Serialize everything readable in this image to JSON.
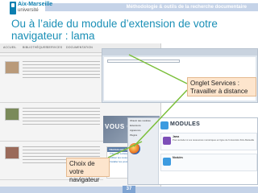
{
  "header": {
    "logo_name": "Aix-Marseille",
    "logo_sub": "université",
    "strip_text": "Méthodologie & outils de la recherche documentaire"
  },
  "slide": {
    "title": "Ou à l’aide du module d’extension de votre navigateur : lama"
  },
  "left_shot": {
    "tabs": [
      "ACCUEIL",
      "BIBLIOTHÈQUES",
      "SERVICES",
      "DOCUMENTATION"
    ],
    "vous_text": "VOUS QUESTION",
    "side_panel_title": "TRAVAILLER À DISTANCE",
    "side_panel_items": [
      "Travailler à distance",
      "Utiliser les ressources",
      "Installer les postes"
    ]
  },
  "modules": {
    "title": "MODULES",
    "row1_name": "Jama",
    "row1_desc": "Pour accéder à vos ressources numériques en ligne de l'université d'Aix-Marseille",
    "row2_name": "Modules",
    "sidebar": [
      "Obtenir des modules",
      "Extensions",
      "Apparence",
      "Plugins"
    ]
  },
  "callouts": {
    "services_tab": "Onglet Services :\nTravailler à distance",
    "navigator_choice": "Choix de votre navigateur"
  },
  "footer": {
    "page_number": "37"
  }
}
